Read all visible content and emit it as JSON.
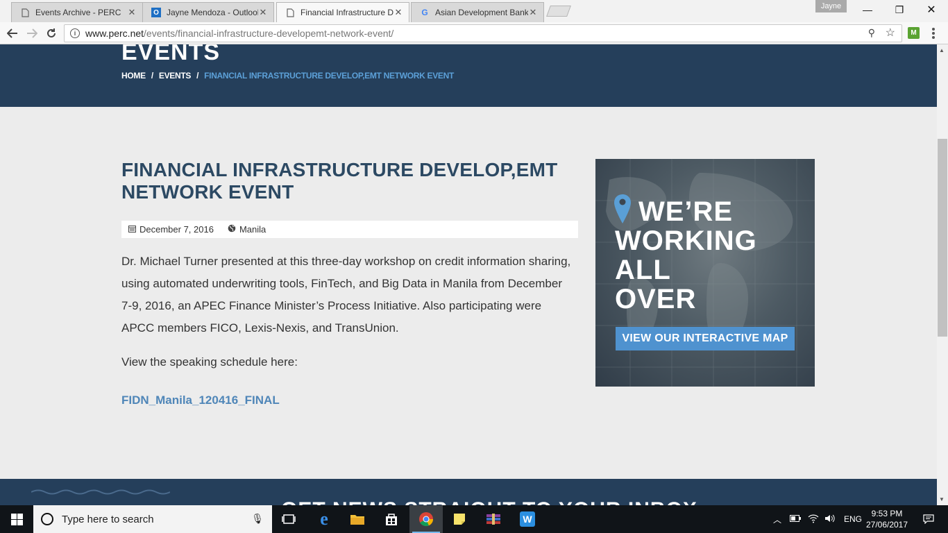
{
  "browser": {
    "tabs": [
      {
        "title": "Events Archive - PERC",
        "favicon": "page-icon",
        "active": false
      },
      {
        "title": "Jayne Mendoza - Outlook",
        "favicon": "outlook-icon",
        "active": false
      },
      {
        "title": "Financial Infrastructure Dev",
        "favicon": "page-icon",
        "active": true
      },
      {
        "title": "Asian Development Bank",
        "favicon": "google-icon",
        "active": false
      }
    ],
    "profile_name": "Jayne",
    "url_host": "www.perc.net",
    "url_path": "/events/financial-infrastructure-developemt-network-event/",
    "extension_label": "M"
  },
  "page": {
    "hero_title": "EVENTS",
    "breadcrumbs": [
      {
        "label": "HOME"
      },
      {
        "label": "EVENTS"
      },
      {
        "label": "FINANCIAL INFRASTRUCTURE DEVELOP,EMT NETWORK EVENT"
      }
    ],
    "breadcrumb_separator": "/",
    "title": "FINANCIAL INFRASTRUCTURE DEVELOP,EMT NETWORK EVENT",
    "meta": {
      "date": "December 7, 2016",
      "location": "Manila"
    },
    "body": "Dr. Michael Turner presented at this three-day workshop on credit information sharing, using automated underwriting tools, FinTech, and Big Data in Manila from December 7-9, 2016, an APEC Finance Minister’s Process Initiative. Also participating were APCC members FICO, Lexis-Nexis, and TransUnion.",
    "schedule_text": "View the speaking schedule here:",
    "file_link": "FIDN_Manila_120416_FINAL",
    "ad": {
      "headline": [
        "WE’RE",
        "WORKING",
        "ALL",
        "OVER"
      ],
      "cta": "VIEW OUR INTERACTIVE MAP"
    },
    "footer_heading": "GET NEWS STRAIGHT TO YOUR INBOX"
  },
  "taskbar": {
    "search_placeholder": "Type here to search",
    "language": "ENG",
    "time": "9:53 PM",
    "date": "27/06/2017"
  },
  "colors": {
    "hero_bg": "#253f5b",
    "title": "#2c4963",
    "link": "#4f86b8",
    "breadcrumb_current": "#5ca0d8",
    "cta": "#4f92cf"
  }
}
